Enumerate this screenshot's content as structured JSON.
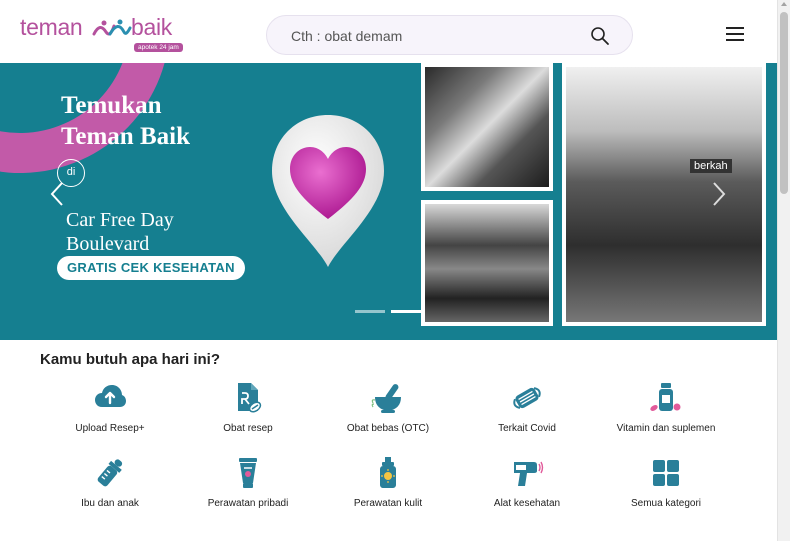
{
  "header": {
    "logo_teman": "teman",
    "logo_baik": "baik",
    "logo_tag": "apotek 24 jam",
    "search_placeholder": "Cth : obat demam"
  },
  "banner": {
    "title_line1": "Temukan",
    "title_line2": "Teman Baik",
    "di": "di",
    "event_line1": "Car Free Day",
    "event_line2": "Boulevard",
    "badge": "GRATIS CEK KESEHATAN",
    "photo_sign": "berkah",
    "active_slide": 2,
    "slide_count": 2
  },
  "categories": {
    "heading": "Kamu butuh apa hari ini?",
    "items": [
      {
        "label": "Upload Resep+",
        "icon": "cloud-upload-icon"
      },
      {
        "label": "Obat resep",
        "icon": "prescription-icon"
      },
      {
        "label": "Obat bebas (OTC)",
        "icon": "mortar-pestle-icon"
      },
      {
        "label": "Terkait Covid",
        "icon": "mask-icon"
      },
      {
        "label": "Vitamin dan suplemen",
        "icon": "vitamin-bottle-icon"
      },
      {
        "label": "Ibu dan anak",
        "icon": "baby-bottle-icon"
      },
      {
        "label": "Perawatan pribadi",
        "icon": "lotion-tube-icon"
      },
      {
        "label": "Perawatan kulit",
        "icon": "sunscreen-icon"
      },
      {
        "label": "Alat kesehatan",
        "icon": "thermometer-gun-icon"
      },
      {
        "label": "Semua kategori",
        "icon": "grid-icon"
      }
    ]
  },
  "colors": {
    "brand": "#b4519d",
    "banner": "#157f90",
    "icon": "#2a7f99"
  }
}
